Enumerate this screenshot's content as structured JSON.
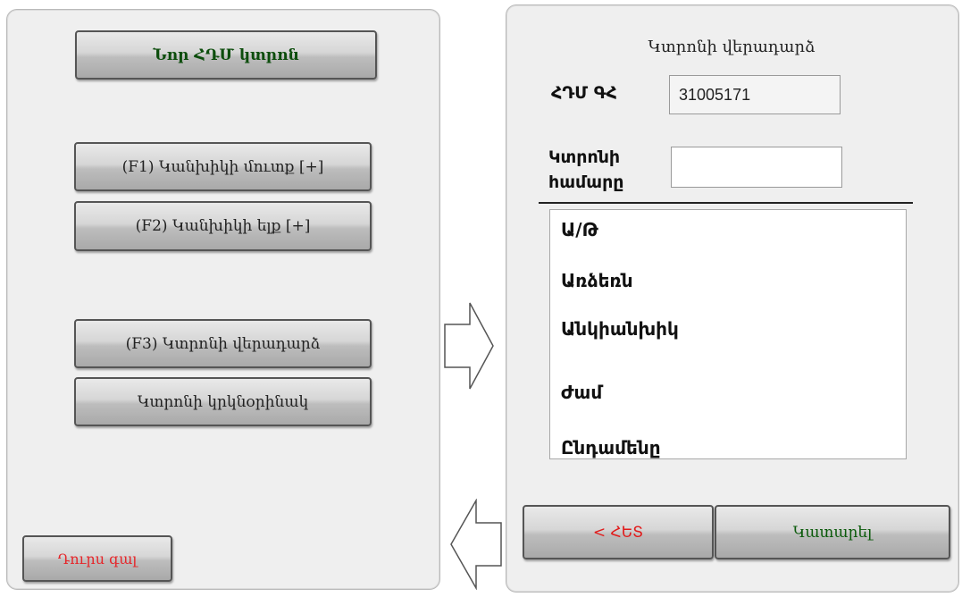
{
  "left_panel": {
    "new_receipt_label": "Նոր ՀԴՄ կտրոն",
    "f1_label": "(F1) Կանխիկի մուտք [+]",
    "f2_label": "(F2) Կանխիկի ելք [+]",
    "f3_label": "(F3) Կտրոնի վերադարձ",
    "copy_label": "Կտրոնի կրկնօրինակ",
    "exit_label": "Դուրս գալ"
  },
  "right_panel": {
    "title": "Կտրոնի վերադարձ",
    "hdm_label": "ՀԴՄ ԳՀ",
    "hdm_value": "31005171",
    "receipt_number_label": "Կտրոնի համարը",
    "receipt_number_value": "",
    "payment_types": [
      "Ա/Թ",
      "Առձեռն",
      "Անկիանխիկ",
      "Ժամ",
      "Ընդամենը"
    ],
    "back_label": "< ՀԵՏ",
    "execute_label": "Կատարել"
  },
  "arrows": {
    "forward_icon": "right-arrow-icon",
    "back_icon": "left-arrow-icon"
  },
  "colors": {
    "back_text": "#e11b1b",
    "execute_text": "#0a5a0a",
    "exit_text": "#e5262a",
    "new_receipt_text": "#0c4d0c"
  }
}
